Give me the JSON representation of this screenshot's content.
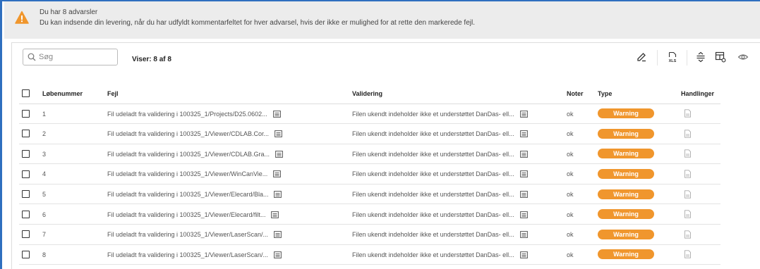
{
  "banner": {
    "title": "Du har 8 advarsler",
    "text": "Du kan indsende din levering, når du har udfyldt kommentarfeltet for hver advarsel, hvis der ikke er mulighed for at rette den markerede fejl.",
    "icon": "warning-icon",
    "icon_color": "#f0962d"
  },
  "toolbar": {
    "search_placeholder": "Søg",
    "count": "Viser: 8 af 8",
    "tools": [
      "edit-icon",
      "xls-export-icon",
      "row-density-icon",
      "column-settings-icon",
      "eye-icon"
    ]
  },
  "table": {
    "headers": {
      "num": "Løbenummer",
      "fejl": "Fejl",
      "validering": "Validering",
      "noter": "Noter",
      "type": "Type",
      "handlinger": "Handlinger"
    },
    "rows": [
      {
        "num": "1",
        "fejl": "Fil udeladt fra validering i 100325_1/Projects/D25.0602...",
        "validering": "Filen ukendt indeholder ikke et understøttet DanDas- ell...",
        "noter": "ok",
        "type": "Warning"
      },
      {
        "num": "2",
        "fejl": "Fil udeladt fra validering i 100325_1/Viewer/CDLAB.Cor...",
        "validering": "Filen ukendt indeholder ikke et understøttet DanDas- ell...",
        "noter": "ok",
        "type": "Warning"
      },
      {
        "num": "3",
        "fejl": "Fil udeladt fra validering i 100325_1/Viewer/CDLAB.Gra...",
        "validering": "Filen ukendt indeholder ikke et understøttet DanDas- ell...",
        "noter": "ok",
        "type": "Warning"
      },
      {
        "num": "4",
        "fejl": "Fil udeladt fra validering i 100325_1/Viewer/WinCanVie...",
        "validering": "Filen ukendt indeholder ikke et understøttet DanDas- ell...",
        "noter": "ok",
        "type": "Warning"
      },
      {
        "num": "5",
        "fejl": "Fil udeladt fra validering i 100325_1/Viewer/Elecard/Bla...",
        "validering": "Filen ukendt indeholder ikke et understøttet DanDas- ell...",
        "noter": "ok",
        "type": "Warning"
      },
      {
        "num": "6",
        "fejl": "Fil udeladt fra validering i 100325_1/Viewer/Elecard/filt...",
        "validering": "Filen ukendt indeholder ikke et understøttet DanDas- ell...",
        "noter": "ok",
        "type": "Warning"
      },
      {
        "num": "7",
        "fejl": "Fil udeladt fra validering i 100325_1/Viewer/LaserScan/...",
        "validering": "Filen ukendt indeholder ikke et understøttet DanDas- ell...",
        "noter": "ok",
        "type": "Warning"
      },
      {
        "num": "8",
        "fejl": "Fil udeladt fra validering i 100325_1/Viewer/LaserScan/...",
        "validering": "Filen ukendt indeholder ikke et understøttet DanDas- ell...",
        "noter": "ok",
        "type": "Warning"
      }
    ],
    "badge_color": "#f0962d"
  }
}
